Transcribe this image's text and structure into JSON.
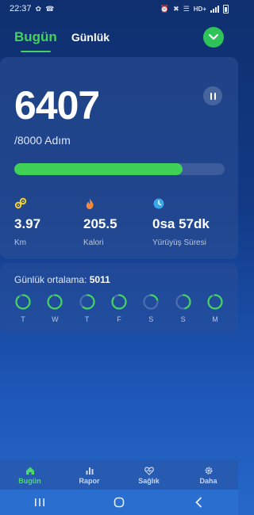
{
  "status": {
    "time": "22:37",
    "network": "HD+"
  },
  "tabs": [
    {
      "label": "Bugün",
      "active": true
    },
    {
      "label": "Günlük",
      "active": false
    }
  ],
  "today": {
    "steps": "6407",
    "goal_text": "/8000 Adım",
    "progress_fraction": 0.8
  },
  "stats": [
    {
      "icon": "distance-icon",
      "value": "3.97",
      "label": "Km"
    },
    {
      "icon": "flame-icon",
      "value": "205.5",
      "label": "Kalori"
    },
    {
      "icon": "clock-icon",
      "value": "0sa 57dk",
      "label": "Yürüyüş Süresi"
    }
  ],
  "daily_average": {
    "label": "Günlük ortalama:",
    "value": "5011",
    "days": [
      {
        "letter": "T",
        "fraction": 0.88
      },
      {
        "letter": "W",
        "fraction": 0.92
      },
      {
        "letter": "T",
        "fraction": 0.6
      },
      {
        "letter": "F",
        "fraction": 0.85
      },
      {
        "letter": "S",
        "fraction": 0.2
      },
      {
        "letter": "S",
        "fraction": 0.45
      },
      {
        "letter": "M",
        "fraction": 0.9
      }
    ]
  },
  "bottom_nav": [
    {
      "label": "Bugün",
      "icon": "home-icon",
      "active": true
    },
    {
      "label": "Rapor",
      "icon": "bar-chart-icon",
      "active": false
    },
    {
      "label": "Sağlık",
      "icon": "heart-pulse-icon",
      "active": false
    },
    {
      "label": "Daha",
      "icon": "gear-icon",
      "active": false
    }
  ],
  "colors": {
    "accent": "#43d35e",
    "background_top": "#0f2f6e",
    "background_bottom": "#2668c8"
  }
}
